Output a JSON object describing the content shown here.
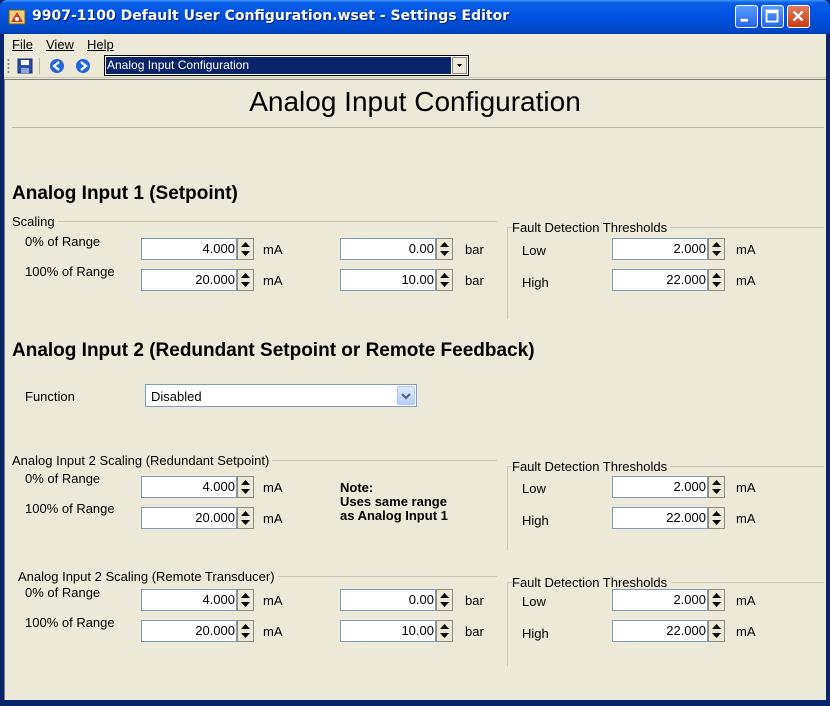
{
  "window": {
    "title": "9907-1100 Default User Configuration.wset - Settings Editor"
  },
  "menu": {
    "file_label": "File",
    "view_label": "View",
    "help_label": "Help"
  },
  "toolbar": {
    "page_select_value": "Analog Input Configuration",
    "icons": [
      "save-icon",
      "back-icon",
      "forward-icon"
    ]
  },
  "page": {
    "title": "Analog Input Configuration"
  },
  "ai1": {
    "title": "Analog Input 1 (Setpoint)",
    "scaling_label": "Scaling",
    "row0_label": "0% of Range",
    "row100_label": "100% of Range",
    "ma_0": "4.000",
    "ma_100": "20.000",
    "bar_0": "0.00",
    "bar_100": "10.00",
    "unit_ma": "mA",
    "unit_bar": "bar",
    "fault_label": "Fault Detection Thresholds",
    "low_label": "Low",
    "high_label": "High",
    "low_value": "2.000",
    "high_value": "22.000"
  },
  "ai2": {
    "title": "Analog Input 2 (Redundant Setpoint or Remote Feedback)",
    "function_label": "Function",
    "function_value": "Disabled",
    "redundant": {
      "group_label": "Analog Input 2 Scaling (Redundant Setpoint)",
      "row0_label": "0% of Range",
      "row100_label": "100% of Range",
      "ma_0": "4.000",
      "ma_100": "20.000",
      "note_line1": "Note:",
      "note_line2": "Uses same range",
      "note_line3": "as Analog Input 1",
      "fault_label": "Fault Detection Thresholds",
      "low_label": "Low",
      "high_label": "High",
      "low_value": "2.000",
      "high_value": "22.000"
    },
    "remote": {
      "group_label": "Analog Input 2 Scaling (Remote Transducer)",
      "row0_label": "0% of Range",
      "row100_label": "100% of Range",
      "ma_0": "4.000",
      "ma_100": "20.000",
      "bar_0": "0.00",
      "bar_100": "10.00",
      "fault_label": "Fault Detection Thresholds",
      "low_label": "Low",
      "high_label": "High",
      "low_value": "2.000",
      "high_value": "22.000"
    }
  }
}
